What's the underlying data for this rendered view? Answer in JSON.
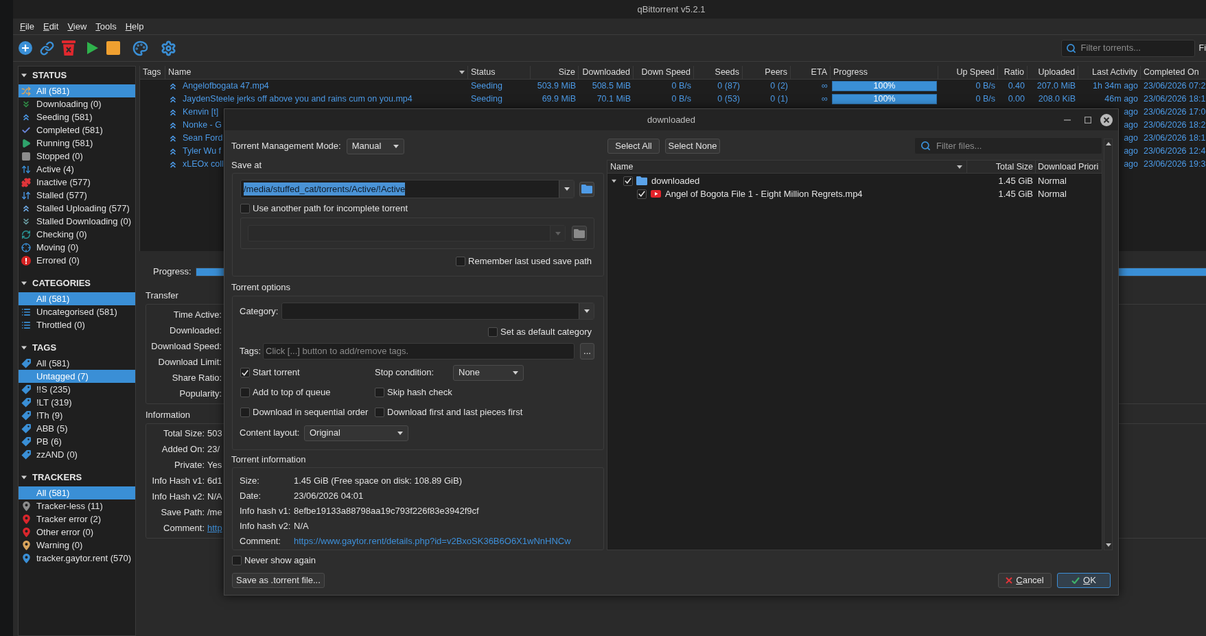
{
  "window": {
    "title": "qBittorrent v5.2.1"
  },
  "menu": [
    "File",
    "Edit",
    "View",
    "Tools",
    "Help"
  ],
  "toolbar": {
    "search": {
      "placeholder": "Filter torrents..."
    },
    "label": "Fi"
  },
  "sidebar": {
    "sections": [
      {
        "title": "STATUS",
        "expanded": true,
        "items": [
          {
            "label": "All (581)",
            "selected": true
          },
          {
            "label": "Downloading (0)",
            "selected": false
          },
          {
            "label": "Seeding (581)",
            "selected": false
          },
          {
            "label": "Completed (581)",
            "selected": false
          },
          {
            "label": "Running (581)",
            "selected": false
          },
          {
            "label": "Stopped (0)",
            "selected": false
          },
          {
            "label": "Active (4)",
            "selected": false
          },
          {
            "label": "Inactive (577)",
            "selected": false
          },
          {
            "label": "Stalled (577)",
            "selected": false
          },
          {
            "label": "Stalled Uploading (577)",
            "selected": false
          },
          {
            "label": "Stalled Downloading (0)",
            "selected": false
          },
          {
            "label": "Checking (0)",
            "selected": false
          },
          {
            "label": "Moving (0)",
            "selected": false
          },
          {
            "label": "Errored (0)",
            "selected": false
          }
        ]
      },
      {
        "title": "CATEGORIES",
        "expanded": true,
        "items": [
          {
            "label": "All (581)",
            "selected": true
          },
          {
            "label": "Uncategorised (581)",
            "selected": false
          },
          {
            "label": "Throttled (0)",
            "selected": false
          }
        ]
      },
      {
        "title": "TAGS",
        "expanded": true,
        "items": [
          {
            "label": "All (581)",
            "selected": false
          },
          {
            "label": "Untagged (7)",
            "selected": true
          },
          {
            "label": "!!S (235)",
            "selected": false
          },
          {
            "label": "!LT (319)",
            "selected": false
          },
          {
            "label": "!Th (9)",
            "selected": false
          },
          {
            "label": "ABB (5)",
            "selected": false
          },
          {
            "label": "PB (6)",
            "selected": false
          },
          {
            "label": "zzAND (0)",
            "selected": false
          }
        ]
      },
      {
        "title": "TRACKERS",
        "expanded": true,
        "items": [
          {
            "label": "All (581)",
            "selected": true
          },
          {
            "label": "Tracker-less (11)",
            "selected": false
          },
          {
            "label": "Tracker error (2)",
            "selected": false
          },
          {
            "label": "Other error (0)",
            "selected": false
          },
          {
            "label": "Warning (0)",
            "selected": false
          },
          {
            "label": "tracker.gaytor.rent (570)",
            "selected": false
          }
        ]
      }
    ]
  },
  "table": {
    "columns": [
      {
        "label": "Tags",
        "sorted": false
      },
      {
        "label": "Name",
        "sorted": true
      },
      {
        "label": "Status",
        "sorted": false
      },
      {
        "label": "Size",
        "sorted": false
      },
      {
        "label": "Downloaded",
        "sorted": false
      },
      {
        "label": "Down Speed",
        "sorted": false
      },
      {
        "label": "Seeds",
        "sorted": false
      },
      {
        "label": "Peers",
        "sorted": false
      },
      {
        "label": "ETA",
        "sorted": false
      },
      {
        "label": "Progress",
        "sorted": false
      },
      {
        "label": "Up Speed",
        "sorted": false
      },
      {
        "label": "Ratio",
        "sorted": false
      },
      {
        "label": "Uploaded",
        "sorted": false
      },
      {
        "label": "Last Activity",
        "sorted": false
      },
      {
        "label": "Completed On",
        "sorted": false
      }
    ],
    "rows": [
      {
        "name": "Angelofbogata 47.mp4",
        "status": "Seeding",
        "size": "503.9 MiB",
        "downloaded": "508.5 MiB",
        "down_speed": "0 B/s",
        "seeds": "0 (87)",
        "peers": "0 (2)",
        "eta": "∞",
        "progress": {
          "text": "100%",
          "level": 1
        },
        "up_speed": "0 B/s",
        "ratio": "0.40",
        "uploaded": "207.0 MiB",
        "last_activity": "1h 34m ago",
        "completed_on": "23/06/2026 07:2"
      },
      {
        "name": "JaydenSteele jerks off above you and rains cum on you.mp4",
        "status": "Seeding",
        "size": "69.9 MiB",
        "downloaded": "70.1 MiB",
        "down_speed": "0 B/s",
        "seeds": "0 (53)",
        "peers": "0 (1)",
        "eta": "∞",
        "progress": {
          "text": "100%",
          "level": 1
        },
        "up_speed": "0 B/s",
        "ratio": "0.00",
        "uploaded": "208.0 KiB",
        "last_activity": "46m ago",
        "completed_on": "23/06/2026 18:1"
      },
      {
        "name": "Kenvin [t]",
        "last_activity": "ago",
        "completed_on": "23/06/2026 17:0"
      },
      {
        "name": "Nonke - G",
        "last_activity": "ago",
        "completed_on": "23/06/2026 18:2"
      },
      {
        "name": "Sean Ford",
        "last_activity": "ago",
        "completed_on": "23/06/2026 18:1"
      },
      {
        "name": "Tyler Wu f",
        "last_activity": "ago",
        "completed_on": "23/06/2026 12:4"
      },
      {
        "name": "xLEOx coll",
        "last_activity": "ago",
        "completed_on": "23/06/2026 19:3"
      }
    ]
  },
  "properties": {
    "progress": {
      "label": "Progress:",
      "level": 1
    },
    "transfer": {
      "title": "Transfer",
      "fields": [
        {
          "label": "Time Active:"
        },
        {
          "label": "Downloaded:"
        },
        {
          "label": "Download Speed:"
        },
        {
          "label": "Download Limit:"
        },
        {
          "label": "Share Ratio:"
        },
        {
          "label": "Popularity:"
        }
      ]
    },
    "information": {
      "title": "Information",
      "fields": [
        {
          "label": "Total Size:",
          "value": "503",
          "kind": "text"
        },
        {
          "label": "Added On:",
          "value": "23/",
          "kind": "text"
        },
        {
          "label": "Private:",
          "value": "Yes",
          "kind": "text"
        },
        {
          "label": "Info Hash v1:",
          "value": "6d1",
          "kind": "text"
        },
        {
          "label": "Info Hash v2:",
          "value": "N/A",
          "kind": "text"
        },
        {
          "label": "Save Path:",
          "value": "/me",
          "kind": "text"
        },
        {
          "label": "Comment:",
          "value": "http",
          "kind": "link"
        }
      ]
    }
  },
  "dialog": {
    "title": "downloaded",
    "management_mode": {
      "label": "Torrent Management Mode:",
      "value": "Manual"
    },
    "save_at": {
      "title": "Save at",
      "path": {
        "value": "/media/stuffed_cat/torrents/Active/!Active",
        "text_selected": true
      },
      "incomplete_path": {
        "label": "Use another path for incomplete torrent",
        "checked": false,
        "field": {
          "disabled": true
        }
      },
      "remember": {
        "label": "Remember last used save path",
        "checked": false
      }
    },
    "torrent_options": {
      "title": "Torrent options",
      "category": {
        "label": "Category:"
      },
      "default_category": {
        "label": "Set as default category",
        "checked": false
      },
      "tags": {
        "label": "Tags:",
        "placeholder": "Click [...] button to add/remove tags.",
        "button": "..."
      },
      "options": [
        {
          "kind": "checkbox",
          "label": "Start torrent",
          "checked": true
        },
        {
          "kind": "dropdown",
          "label": "Stop condition:",
          "value": "None"
        },
        {
          "kind": "checkbox",
          "label": "Add to top of queue",
          "checked": false
        },
        {
          "kind": "checkbox",
          "label": "Skip hash check",
          "checked": false
        },
        {
          "kind": "checkbox",
          "label": "Download in sequential order",
          "checked": false
        },
        {
          "kind": "checkbox",
          "label": "Download first and last pieces first",
          "checked": false
        }
      ],
      "content_layout": {
        "label": "Content layout:",
        "value": "Original"
      }
    },
    "torrent_information": {
      "title": "Torrent information",
      "fields": [
        {
          "label": "Size:",
          "value": "1.45 GiB (Free space on disk: 108.89 GiB)",
          "kind": "text"
        },
        {
          "label": "Date:",
          "value": "23/06/2026 04:01",
          "kind": "text"
        },
        {
          "label": "Info hash v1:",
          "value": "8efbe19133a88798aa19c793f226f83e3942f9cf",
          "kind": "text"
        },
        {
          "label": "Info hash v2:",
          "value": "N/A",
          "kind": "text"
        },
        {
          "label": "Comment:",
          "value": "https://www.gaytor.rent/details.php?id=v2BxoSK36B6O6X1wNnHNCw",
          "kind": "link"
        }
      ]
    },
    "never_show_again": {
      "label": "Never show again",
      "checked": false
    },
    "save_torrent_button": "Save as .torrent file...",
    "file_buttons": [
      "Select All",
      "Select None"
    ],
    "filter": {
      "placeholder": "Filter files..."
    },
    "files": {
      "columns": [
        {
          "label": "Name",
          "sorted": true
        },
        {
          "label": "Total Size",
          "sorted": false
        },
        {
          "label": "Download Priori",
          "sorted": false
        }
      ],
      "items": [
        {
          "kind": "folder",
          "name": "downloaded",
          "checked": true,
          "expanded": true,
          "size": "1.45 GiB",
          "priority": "Normal",
          "children": [
            {
              "kind": "file",
              "name": "Angel of Bogota File 1 - Eight Million Regrets.mp4",
              "checked": true,
              "size": "1.45 GiB",
              "priority": "Normal"
            }
          ]
        }
      ]
    },
    "buttons": [
      {
        "kind": "cancel",
        "label": "Cancel",
        "focused": false
      },
      {
        "kind": "ok",
        "label": "OK",
        "focused": true
      }
    ]
  }
}
